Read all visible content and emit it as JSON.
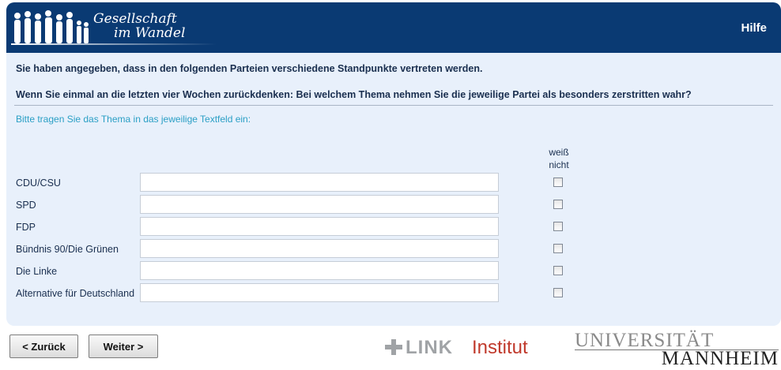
{
  "header": {
    "logo_line1": "Gesellschaft",
    "logo_line2": "im Wandel",
    "help_label": "Hilfe"
  },
  "intro": "Sie haben angegeben, dass in den folgenden Parteien verschiedene Standpunkte vertreten werden.",
  "question": "Wenn Sie einmal an die letzten vier Wochen zurückdenken: Bei welchem Thema nehmen Sie die jeweilige Partei als besonders zerstritten wahr?",
  "instruction": "Bitte tragen Sie das Thema in das jeweilige Textfeld ein:",
  "dont_know_header": {
    "line1": "weiß",
    "line2": "nicht"
  },
  "rows": [
    {
      "label": "CDU/CSU",
      "value": "",
      "dont_know": false
    },
    {
      "label": "SPD",
      "value": "",
      "dont_know": false
    },
    {
      "label": "FDP",
      "value": "",
      "dont_know": false
    },
    {
      "label": "Bündnis 90/Die Grünen",
      "value": "",
      "dont_know": false
    },
    {
      "label": "Die Linke",
      "value": "",
      "dont_know": false
    },
    {
      "label": "Alternative für Deutschland",
      "value": "",
      "dont_know": false
    }
  ],
  "buttons": {
    "back": "< Zurück",
    "next": "Weiter >"
  },
  "footer_logos": {
    "link_word": "LINK",
    "link_institut": "Institut",
    "uni_line1": "UNIVERSITÄT",
    "uni_line2": "MANNHEIM"
  },
  "colors": {
    "header_bg": "#0a3a73",
    "content_bg": "#e8f0fb",
    "instruction_text": "#2a9fc5",
    "link_red": "#c0392b"
  }
}
